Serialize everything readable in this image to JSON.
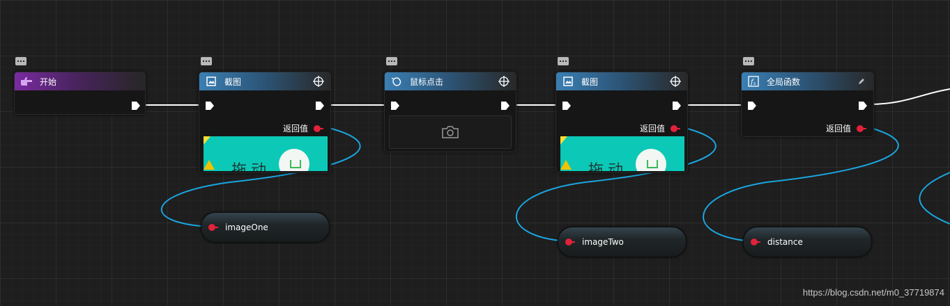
{
  "nodes": {
    "start": {
      "title": "开始"
    },
    "screenshot1": {
      "title": "截图",
      "return_label": "返回值"
    },
    "mouse_click": {
      "title": "鼠标点击"
    },
    "screenshot2": {
      "title": "截图",
      "return_label": "返回值"
    },
    "global_function": {
      "title": "全局函数",
      "return_label": "返回值"
    }
  },
  "thumbnail_text": {
    "main": "拖动",
    "edge": "Ш"
  },
  "variables": [
    {
      "label": "imageOne"
    },
    {
      "label": "imageTwo"
    },
    {
      "label": "distance"
    }
  ],
  "watermark": "https://blog.csdn.net/m0_37719874",
  "colors": {
    "background": "#1e1e1e",
    "header_purple": "#7a2aa0",
    "header_blue": "#3a7fb3",
    "exec_wire": "#ffffff",
    "data_wire": "#1aa6e0",
    "data_pin": "#e0223b",
    "thumbnail": "#0bc9b6"
  }
}
